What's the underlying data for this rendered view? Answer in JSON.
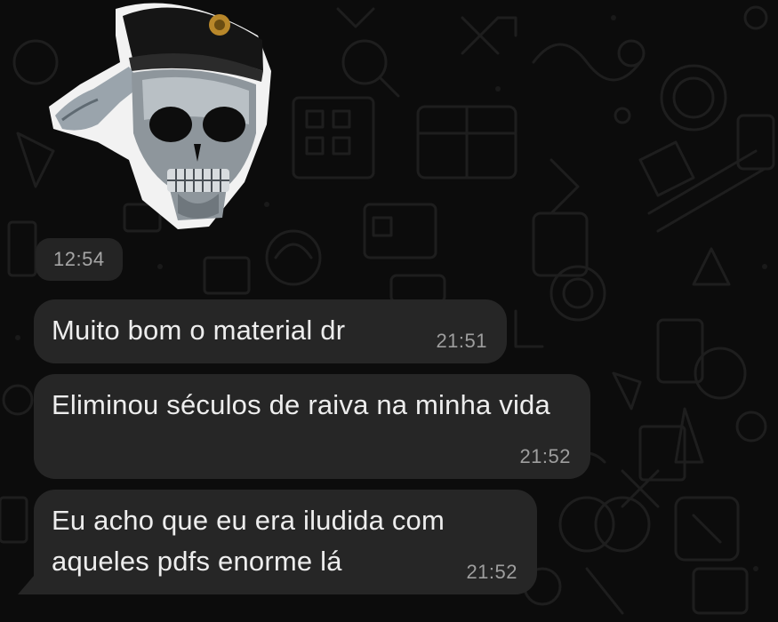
{
  "sticker": {
    "icon": "saluting-skull-soldier-sticker",
    "timestamp": "12:54"
  },
  "messages": [
    {
      "text": "Muito bom o material dr",
      "time": "21:51"
    },
    {
      "text": "Eliminou séculos de raiva na minha vida",
      "time": "21:52"
    },
    {
      "text": "Eu acho que eu era iludida com aqueles pdfs enorme lá",
      "time": "21:52"
    }
  ],
  "colors": {
    "background": "#0c0c0c",
    "bubble": "#262626",
    "text": "#ededed",
    "timestamp": "#9e9e9e"
  }
}
